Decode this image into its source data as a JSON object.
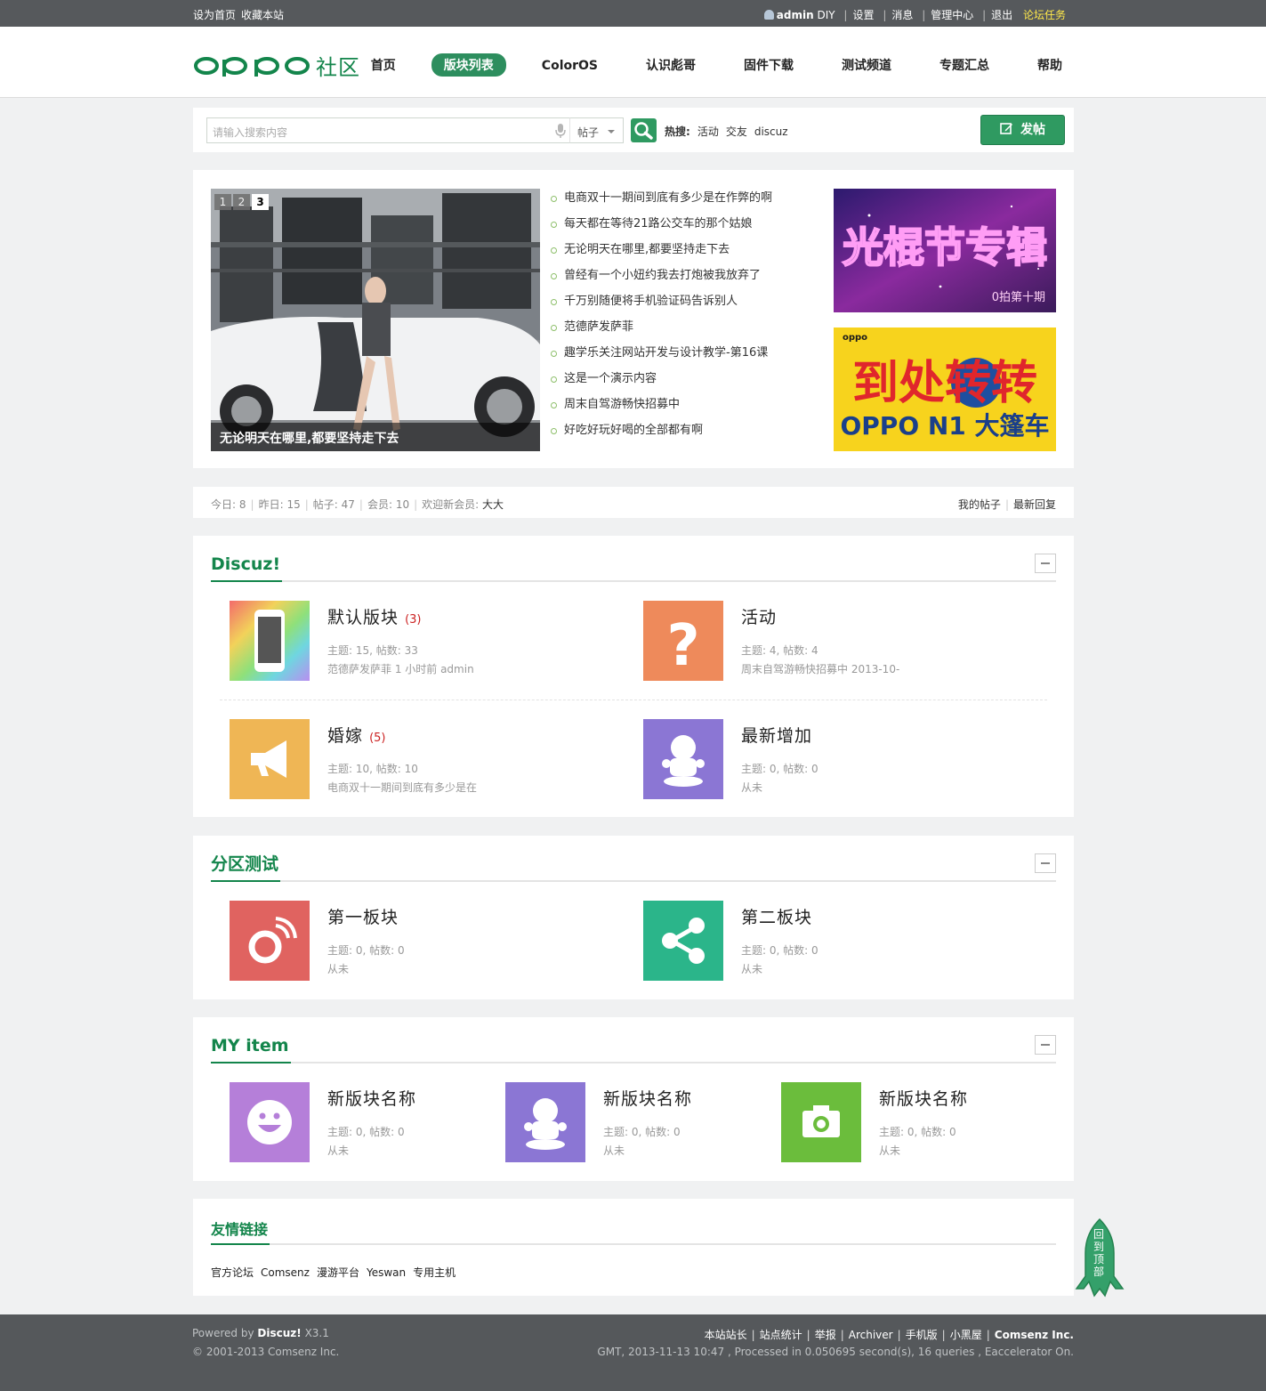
{
  "topbar": {
    "set_home": "设为首页",
    "bookmark": "收藏本站",
    "username": "admin",
    "diy": "DIY",
    "settings": "设置",
    "messages": "消息",
    "admin_center": "管理中心",
    "logout": "退出",
    "tasks": "论坛任务"
  },
  "header": {
    "logo_text": "oppo",
    "logo_suffix": "社区",
    "nav": [
      "首页",
      "版块列表",
      "ColorOS",
      "认识彪哥",
      "固件下载",
      "测试频道",
      "专题汇总",
      "帮助"
    ],
    "nav_active": 1
  },
  "search": {
    "placeholder": "请输入搜索内容",
    "type": "帖子",
    "hot_label": "热搜:",
    "hot_keywords": [
      "活动",
      "交友",
      "discuz"
    ],
    "post_button": "发帖"
  },
  "featured": {
    "pager": [
      "1",
      "2",
      "3"
    ],
    "pager_active": 2,
    "caption": "无论明天在哪里,都要坚持走下去",
    "news": [
      "电商双十一期间到底有多少是在作弊的啊",
      "每天都在等待21路公交车的那个姑娘",
      "无论明天在哪里,都要坚持走下去",
      "曾经有一个小妞约我去打炮被我放弃了",
      "千万别随便将手机验证码告诉别人",
      "范德萨发萨菲",
      "趣学乐关注网站开发与设计教学-第16课",
      "这是一个演示内容",
      "周末自驾游畅快招募中",
      "好吃好玩好喝的全部都有啊"
    ],
    "ad1_title": "光棍节专辑",
    "ad1_sub": "0拍第十期",
    "ad2_brand": "oppo",
    "ad2_line1": "到处转转",
    "ad2_line2": "OPPO N1 大篷车"
  },
  "stats": {
    "today_label": "今日:",
    "today": "8",
    "yesterday_label": "昨日:",
    "yesterday": "15",
    "posts_label": "帖子:",
    "posts": "47",
    "members_label": "会员:",
    "members": "10",
    "welcome_label": "欢迎新会员:",
    "newest_member": "大大",
    "my_posts": "我的帖子",
    "latest_replies": "最新回复"
  },
  "sections": [
    {
      "title": "Discuz!",
      "forums": [
        {
          "name": "默认版块",
          "count": "(3)",
          "stat": "主题: 15, 帖数: 33",
          "last": "范德萨发萨菲 1 小时前 admin",
          "icon": "phone-icon",
          "color": "#9fd96a"
        },
        {
          "name": "活动",
          "count": "",
          "stat": "主题: 4, 帖数: 4",
          "last": "周末自驾游畅快招募中 2013-10-",
          "icon": "question-icon",
          "color": "#ee8a5b"
        },
        {
          "name": "婚嫁",
          "count": "(5)",
          "stat": "主题: 10, 帖数: 10",
          "last": "电商双十一期间到底有多少是在",
          "icon": "megaphone-icon",
          "color": "#efb655"
        },
        {
          "name": "最新增加",
          "count": "",
          "stat": "主题: 0, 帖数: 0",
          "last": "从未",
          "icon": "robot-icon",
          "color": "#8b76d4"
        }
      ]
    },
    {
      "title": "分区测试",
      "forums": [
        {
          "name": "第一板块",
          "count": "",
          "stat": "主题: 0, 帖数: 0",
          "last": "从未",
          "icon": "signal-icon",
          "color": "#e06360"
        },
        {
          "name": "第二板块",
          "count": "",
          "stat": "主题: 0, 帖数: 0",
          "last": "从未",
          "icon": "share-icon",
          "color": "#2bb58a"
        }
      ]
    },
    {
      "title": "MY item",
      "forums": [
        {
          "name": "新版块名称",
          "count": "",
          "stat": "主题: 0, 帖数: 0",
          "last": "从未",
          "icon": "smile-icon",
          "color": "#b57fd9"
        },
        {
          "name": "新版块名称",
          "count": "",
          "stat": "主题: 0, 帖数: 0",
          "last": "从未",
          "icon": "robot-icon",
          "color": "#8b76d4"
        },
        {
          "name": "新版块名称",
          "count": "",
          "stat": "主题: 0, 帖数: 0",
          "last": "从未",
          "icon": "camera-icon",
          "color": "#6bbd3c"
        }
      ]
    }
  ],
  "links": {
    "title": "友情链接",
    "items": [
      "官方论坛",
      "Comsenz",
      "漫游平台",
      "Yeswan",
      "专用主机"
    ]
  },
  "footer": {
    "powered_prefix": "Powered by",
    "powered_name": "Discuz!",
    "version": "X3.1",
    "copyright": "© 2001-2013 Comsenz Inc.",
    "links": [
      "本站站长",
      "站点统计",
      "举报",
      "Archiver",
      "手机版",
      "小黑屋"
    ],
    "company": "Comsenz Inc.",
    "debug": "GMT, 2013-11-13 10:47 , Processed in 0.050695 second(s), 16 queries , Eaccelerator On."
  },
  "backtop": "回到顶部",
  "colors": {
    "brand_green": "#13854b",
    "accent_green": "#2f9a61",
    "topbar": "#56595c",
    "footer": "#55585b",
    "task_yellow": "#ffe94a"
  }
}
